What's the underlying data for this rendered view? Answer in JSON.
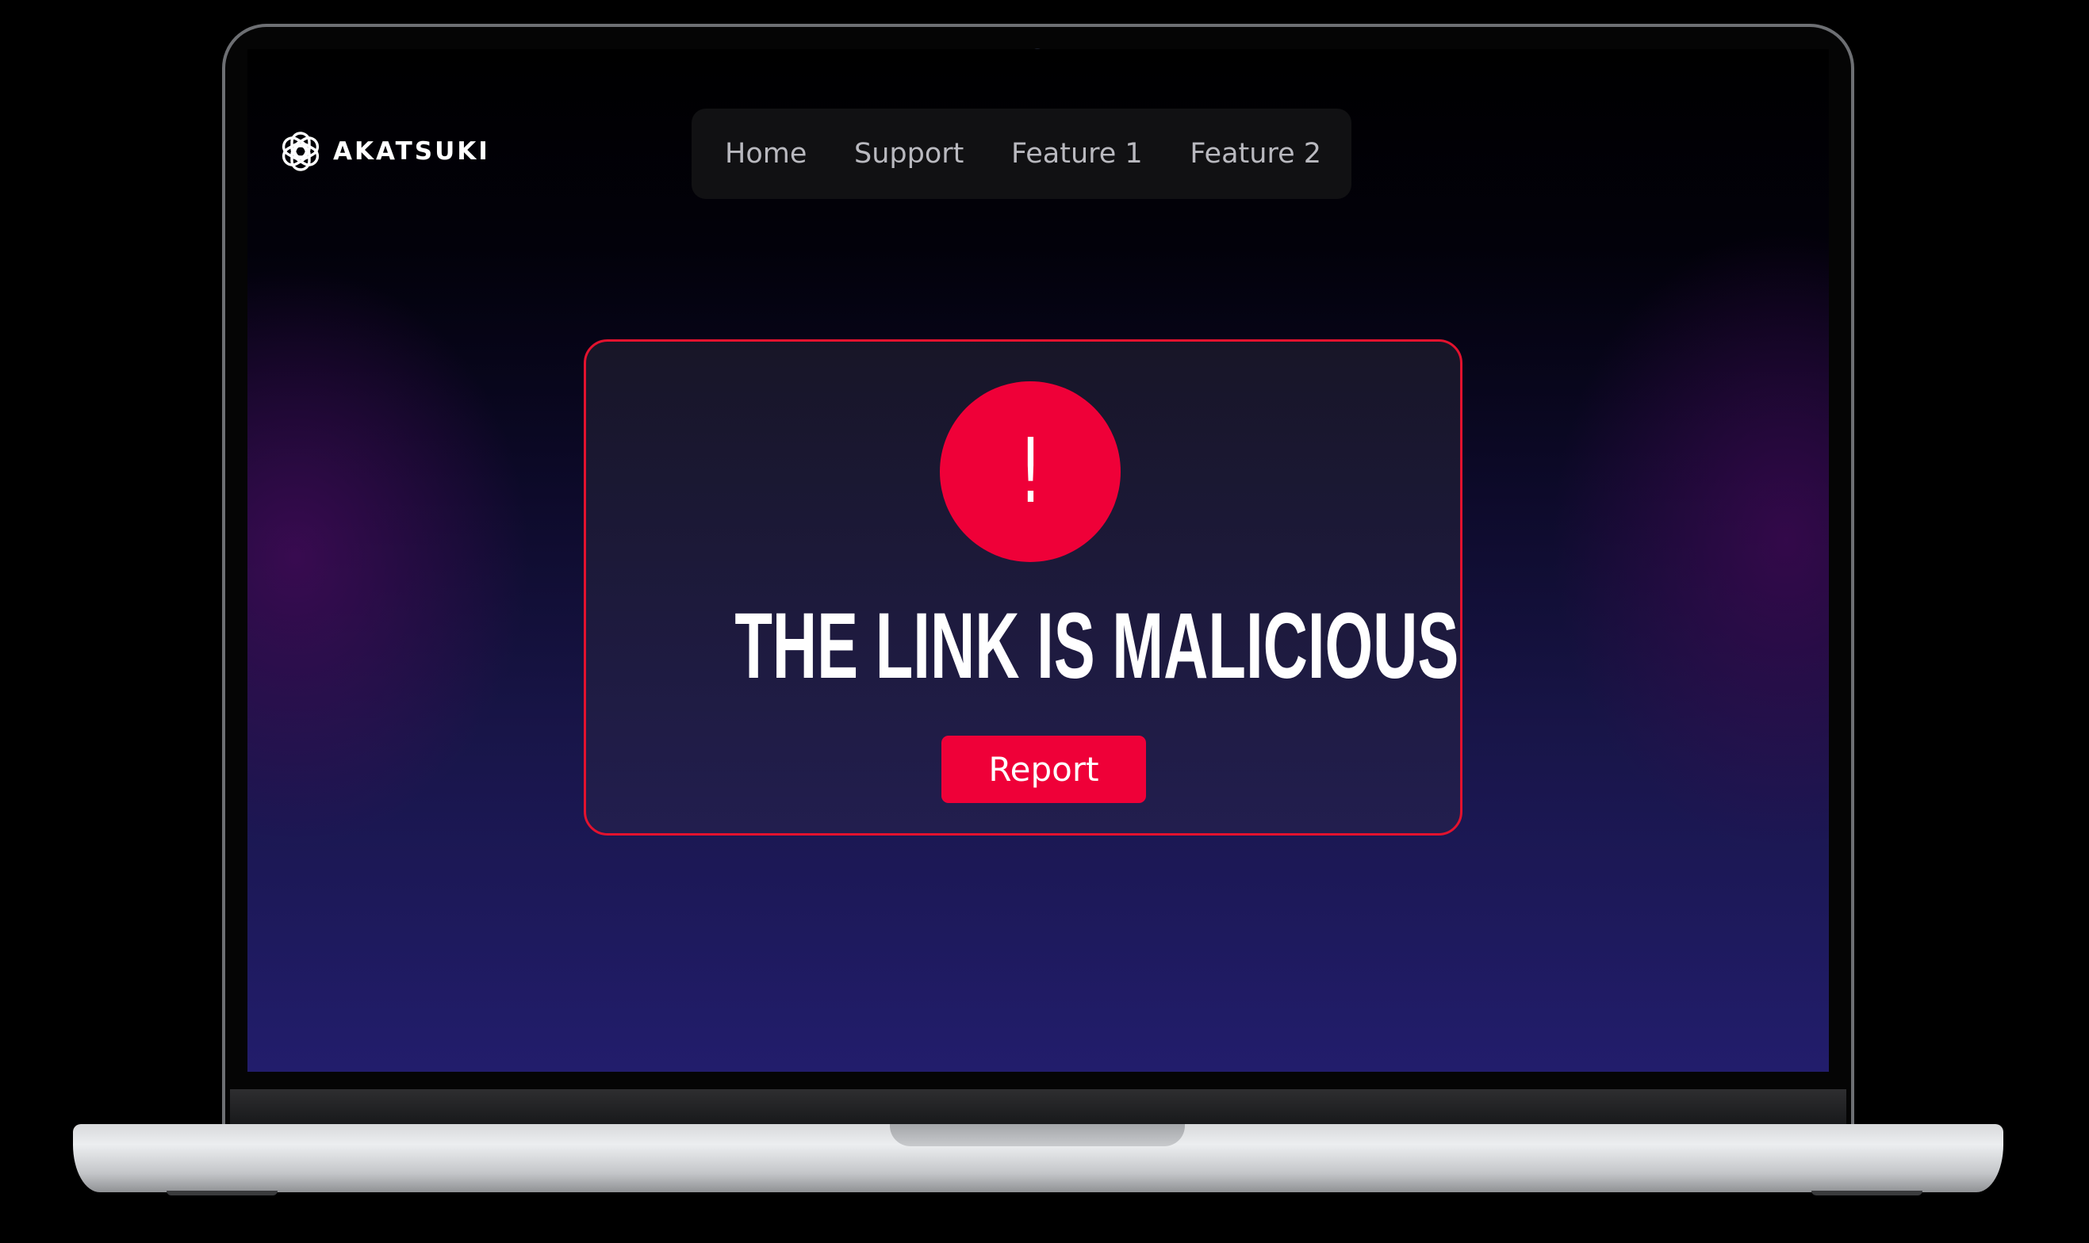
{
  "brand": {
    "name": "AKATSUKI",
    "icon": "openai-knot-icon"
  },
  "nav": {
    "items": [
      {
        "label": "Home"
      },
      {
        "label": "Support"
      },
      {
        "label": "Feature 1"
      },
      {
        "label": "Feature 2"
      }
    ]
  },
  "alert": {
    "icon": "exclamation-icon",
    "mark": "!",
    "title": "THE LINK IS MALICIOUS",
    "button_label": "Report"
  },
  "colors": {
    "accent": "#ef0038",
    "card_border": "#e3122e",
    "nav_background": "#111113",
    "nav_text": "#b9b9bf",
    "screen_bottom": "#221d6c"
  }
}
